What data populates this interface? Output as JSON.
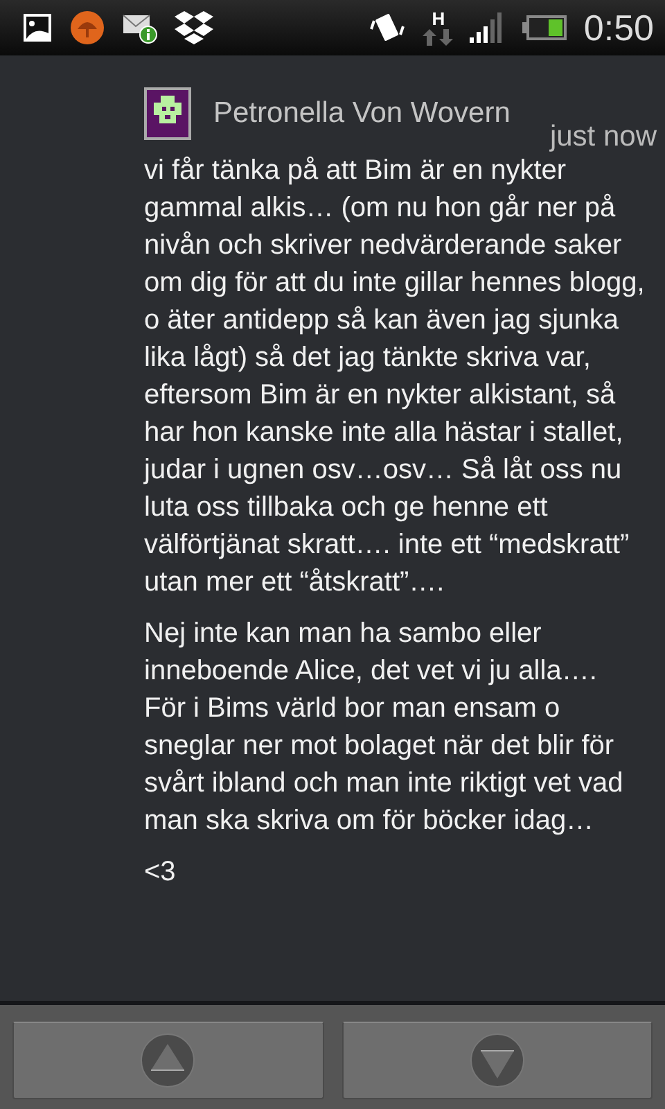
{
  "status_bar": {
    "network_type": "H",
    "time": "0:50"
  },
  "comment": {
    "author": "Petronella Von Wovern",
    "time": "just now",
    "paragraphs": [
      "vi får tänka på att Bim är en nykter gammal alkis… (om nu hon går ner på nivån och skriver nedvärderande saker om dig för att du inte gillar hennes blogg, o äter antidepp så kan även jag sjunka lika lågt) så det jag tänkte skriva var, eftersom Bim är en nykter alkistant, så har hon kanske inte alla hästar i stallet, judar i ugnen osv…osv… Så låt oss nu luta oss tillbaka och ge henne ett välförtjänat skratt…. inte ett “medskratt” utan mer ett “åtskratt”….",
      "Nej inte kan man ha sambo eller inneboende Alice, det vet vi ju alla…. För i Bims värld bor man ensam o sneglar ner mot bolaget när det blir för svårt ibland och man inte riktigt vet vad man ska skriva om för böcker idag…",
      "<3"
    ]
  },
  "nav_buttons": [
    {
      "kind": "up"
    },
    {
      "kind": "down"
    }
  ]
}
